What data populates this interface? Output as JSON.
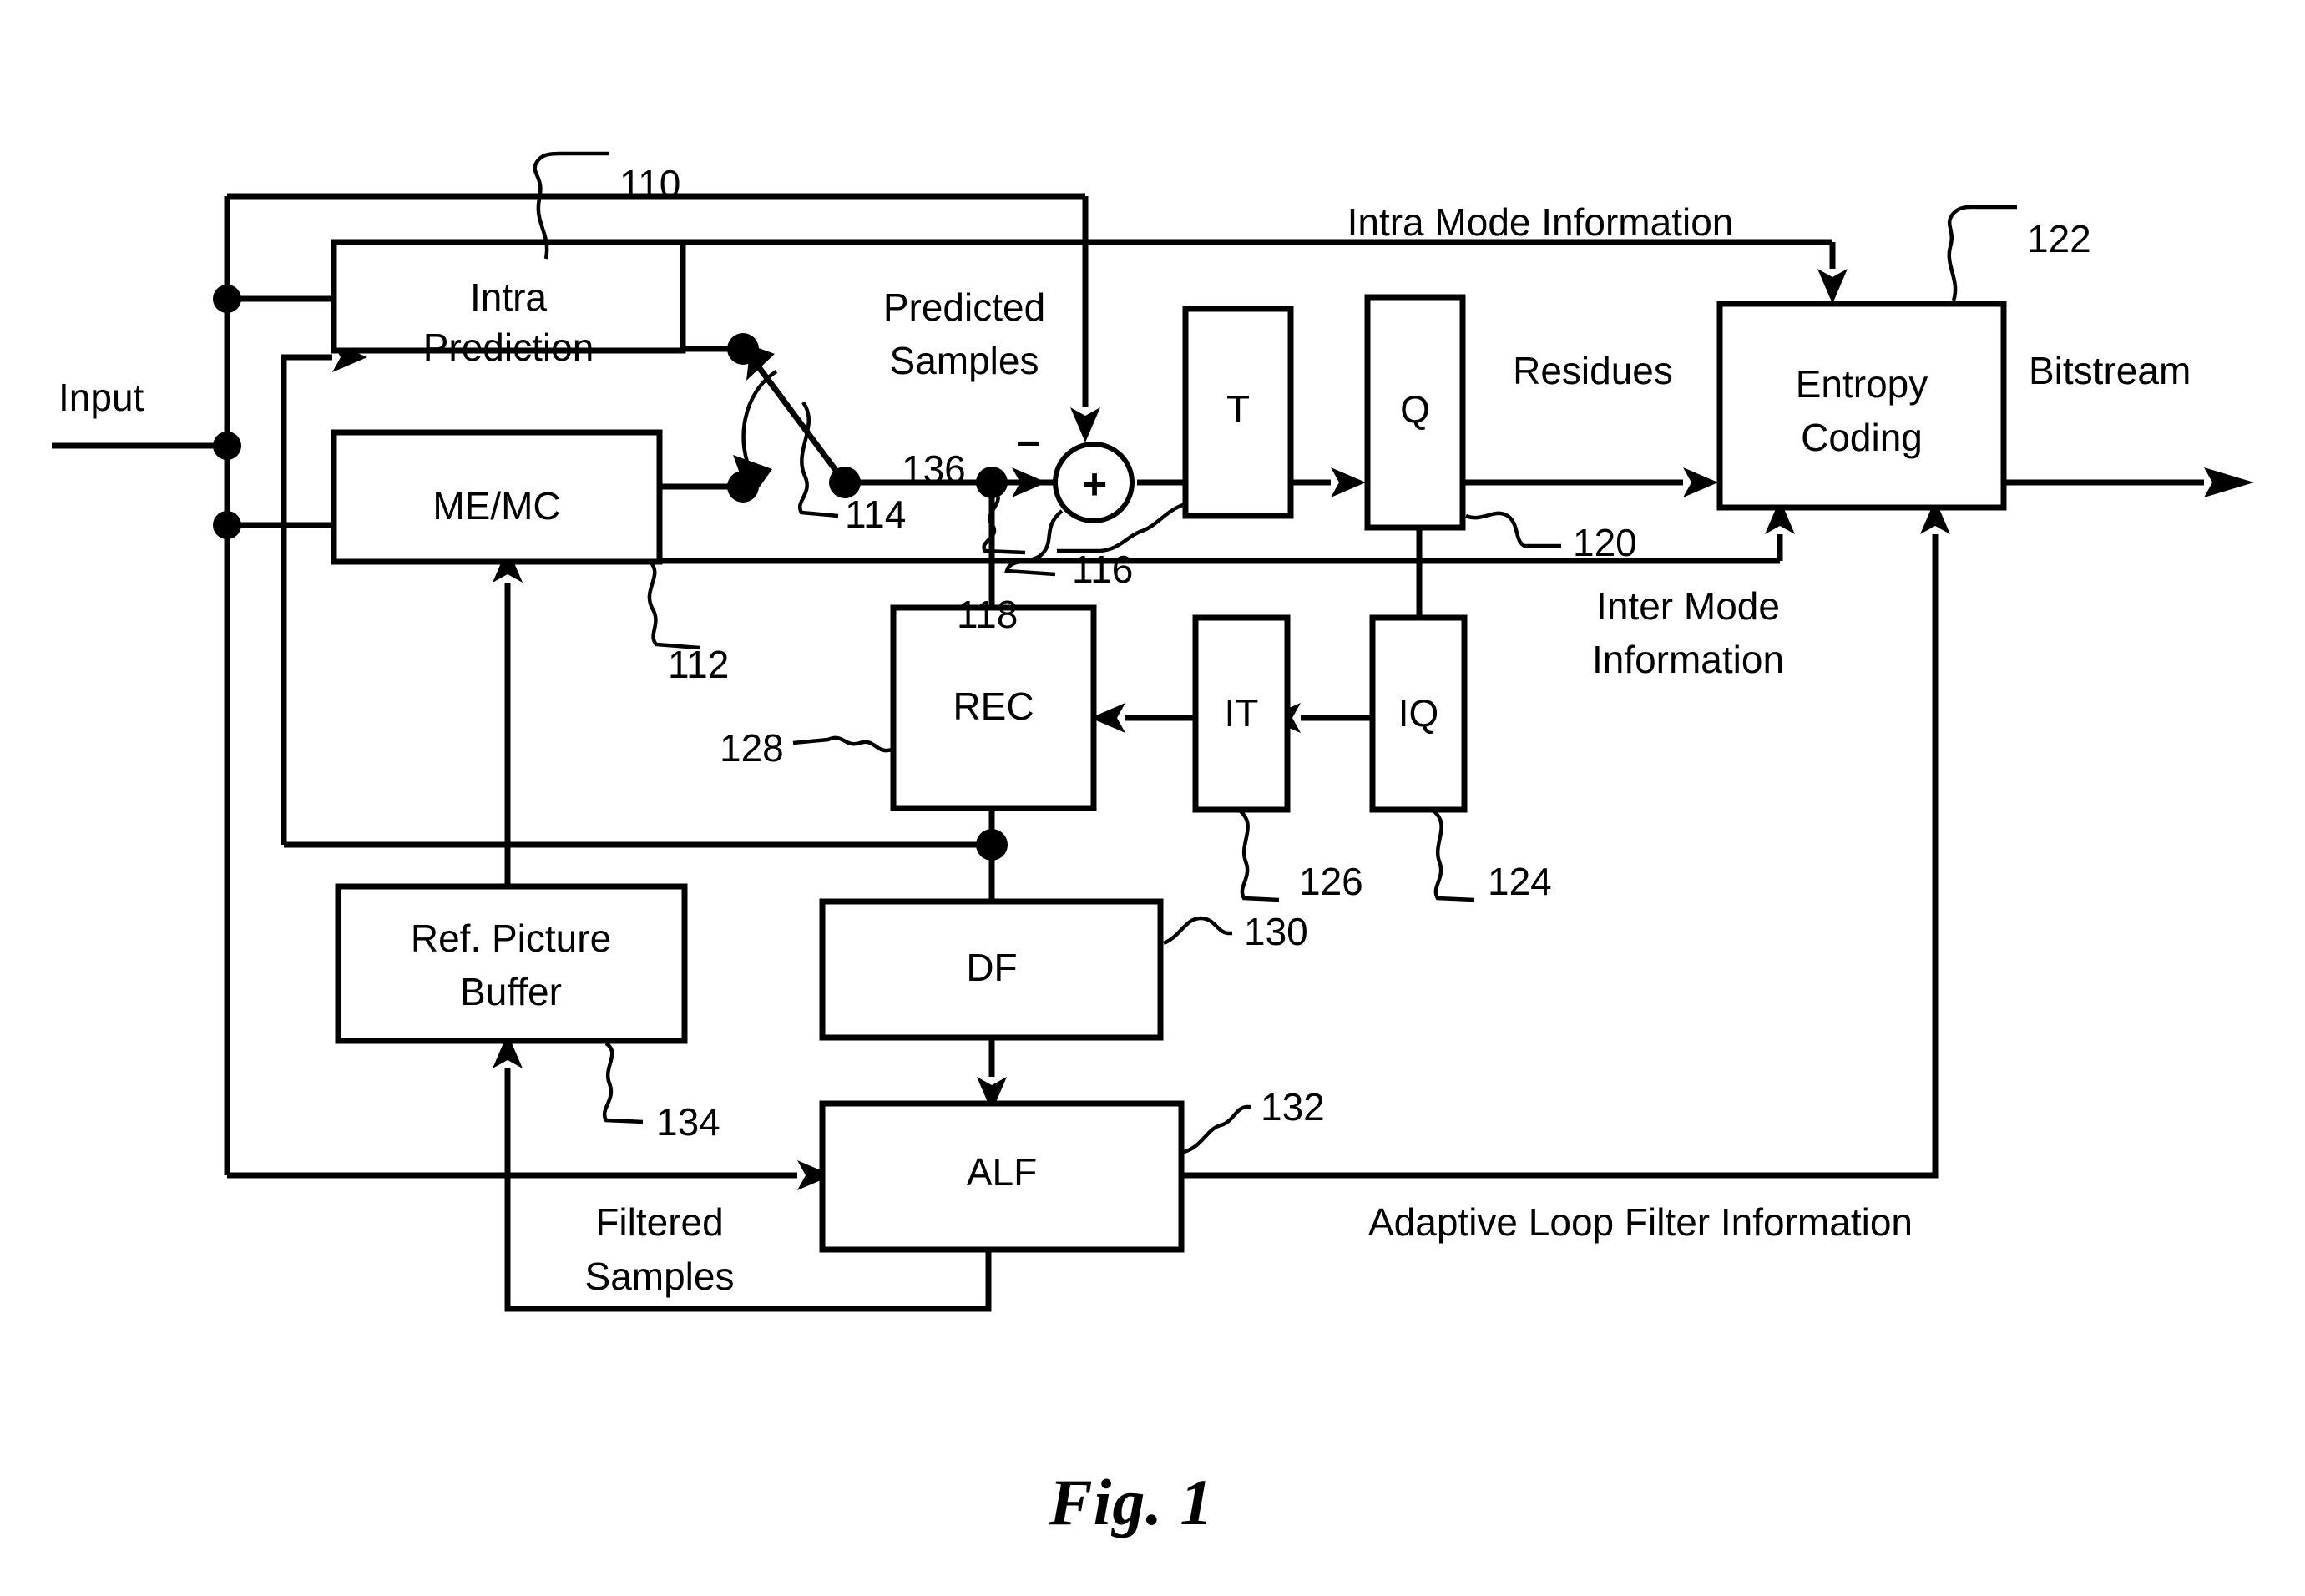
{
  "figure": {
    "caption": "Fig. 1",
    "type": "video-encoder-block-diagram"
  },
  "blocks": [
    {
      "id": "intra_prediction",
      "label_line1": "Intra",
      "label_line2": "Prediction",
      "ref": "110"
    },
    {
      "id": "me_mc",
      "label_line1": "ME/MC",
      "label_line2": "",
      "ref": "112"
    },
    {
      "id": "transform",
      "label_line1": "T",
      "label_line2": "",
      "ref": "118"
    },
    {
      "id": "quantization",
      "label_line1": "Q",
      "label_line2": "",
      "ref": "120"
    },
    {
      "id": "entropy_coding",
      "label_line1": "Entropy",
      "label_line2": "Coding",
      "ref": "122"
    },
    {
      "id": "inverse_quant",
      "label_line1": "IQ",
      "label_line2": "",
      "ref": "124"
    },
    {
      "id": "inverse_transform",
      "label_line1": "IT",
      "label_line2": "",
      "ref": "126"
    },
    {
      "id": "reconstruction",
      "label_line1": "REC",
      "label_line2": "",
      "ref": "128"
    },
    {
      "id": "deblocking_filter",
      "label_line1": "DF",
      "label_line2": "",
      "ref": "130"
    },
    {
      "id": "adaptive_loop_filter",
      "label_line1": "ALF",
      "label_line2": "",
      "ref": "132"
    },
    {
      "id": "ref_picture_buffer",
      "label_line1": "Ref. Picture",
      "label_line2": "Buffer",
      "ref": "134"
    }
  ],
  "switch": {
    "ref": "114",
    "name": "mode-select-switch"
  },
  "adder": {
    "ref": "116",
    "symbol": "+",
    "minus_sign": "–"
  },
  "predicted_samples_node": {
    "ref": "136"
  },
  "signals": {
    "input": "Input",
    "bitstream": "Bitstream",
    "predicted_samples_line1": "Predicted",
    "predicted_samples_line2": "Samples",
    "residues": "Residues",
    "intra_mode_information": "Intra Mode Information",
    "inter_mode_information_line1": "Inter Mode",
    "inter_mode_information_line2": "Information",
    "adaptive_loop_filter_information": "Adaptive Loop Filter Information",
    "filtered_samples_line1": "Filtered",
    "filtered_samples_line2": "Samples"
  },
  "ref_numbers": {
    "r110": "110",
    "r112": "112",
    "r114": "114",
    "r116": "116",
    "r118": "118",
    "r120": "120",
    "r122": "122",
    "r124": "124",
    "r126": "126",
    "r128": "128",
    "r130": "130",
    "r132": "132",
    "r134": "134",
    "r136": "136"
  },
  "colors": {
    "stroke": "#000000",
    "fill": "#ffffff"
  }
}
